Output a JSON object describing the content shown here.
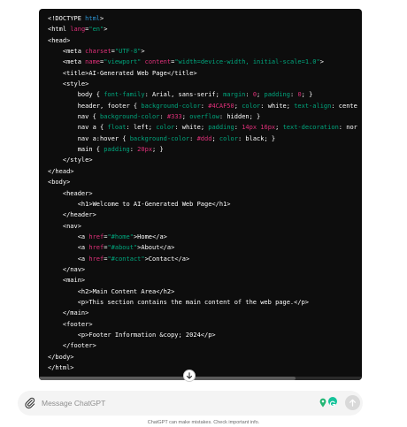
{
  "code_block": {
    "language": "html",
    "colors": {
      "text": "#ffffff",
      "tag": "#2e95d3",
      "attr": "#df3079",
      "string": "#00a67d",
      "css_value": "#df3079",
      "background": "#0d0d0d"
    },
    "lines": [
      [
        {
          "t": "<!DOCTYPE ",
          "c": "text"
        },
        {
          "t": "html",
          "c": "tag"
        },
        {
          "t": ">",
          "c": "text"
        }
      ],
      [
        {
          "t": "<html ",
          "c": "text"
        },
        {
          "t": "lang",
          "c": "attr"
        },
        {
          "t": "=",
          "c": "text"
        },
        {
          "t": "\"en\"",
          "c": "string"
        },
        {
          "t": ">",
          "c": "text"
        }
      ],
      [
        {
          "t": "<head>",
          "c": "text"
        }
      ],
      [
        {
          "t": "    <meta ",
          "c": "text"
        },
        {
          "t": "charset",
          "c": "attr"
        },
        {
          "t": "=",
          "c": "text"
        },
        {
          "t": "\"UTF-8\"",
          "c": "string"
        },
        {
          "t": ">",
          "c": "text"
        }
      ],
      [
        {
          "t": "    <meta ",
          "c": "text"
        },
        {
          "t": "name",
          "c": "attr"
        },
        {
          "t": "=",
          "c": "text"
        },
        {
          "t": "\"viewport\"",
          "c": "string"
        },
        {
          "t": " ",
          "c": "text"
        },
        {
          "t": "content",
          "c": "attr"
        },
        {
          "t": "=",
          "c": "text"
        },
        {
          "t": "\"width=device-width, initial-scale=1.0\"",
          "c": "string"
        },
        {
          "t": ">",
          "c": "text"
        }
      ],
      [
        {
          "t": "    <title>AI-Generated Web Page</title>",
          "c": "text"
        }
      ],
      [
        {
          "t": "    <style>",
          "c": "text"
        }
      ],
      [
        {
          "t": "        body { ",
          "c": "text"
        },
        {
          "t": "font-family",
          "c": "string"
        },
        {
          "t": ": Arial, sans-serif; ",
          "c": "text"
        },
        {
          "t": "margin",
          "c": "string"
        },
        {
          "t": ": ",
          "c": "text"
        },
        {
          "t": "0",
          "c": "css_value"
        },
        {
          "t": "; ",
          "c": "text"
        },
        {
          "t": "padding",
          "c": "string"
        },
        {
          "t": ": ",
          "c": "text"
        },
        {
          "t": "0",
          "c": "css_value"
        },
        {
          "t": "; }",
          "c": "text"
        }
      ],
      [
        {
          "t": "        header, footer { ",
          "c": "text"
        },
        {
          "t": "background-color",
          "c": "string"
        },
        {
          "t": ": ",
          "c": "text"
        },
        {
          "t": "#4CAF50",
          "c": "css_value"
        },
        {
          "t": "; ",
          "c": "text"
        },
        {
          "t": "color",
          "c": "string"
        },
        {
          "t": ": white; ",
          "c": "text"
        },
        {
          "t": "text-align",
          "c": "string"
        },
        {
          "t": ": cente",
          "c": "text"
        }
      ],
      [
        {
          "t": "        nav { ",
          "c": "text"
        },
        {
          "t": "background-color",
          "c": "string"
        },
        {
          "t": ": ",
          "c": "text"
        },
        {
          "t": "#333",
          "c": "css_value"
        },
        {
          "t": "; ",
          "c": "text"
        },
        {
          "t": "overflow",
          "c": "string"
        },
        {
          "t": ": hidden; }",
          "c": "text"
        }
      ],
      [
        {
          "t": "        nav a { ",
          "c": "text"
        },
        {
          "t": "float",
          "c": "string"
        },
        {
          "t": ": left; ",
          "c": "text"
        },
        {
          "t": "color",
          "c": "string"
        },
        {
          "t": ": white; ",
          "c": "text"
        },
        {
          "t": "padding",
          "c": "string"
        },
        {
          "t": ": ",
          "c": "text"
        },
        {
          "t": "14px 16px",
          "c": "css_value"
        },
        {
          "t": "; ",
          "c": "text"
        },
        {
          "t": "text-decoration",
          "c": "string"
        },
        {
          "t": ": nor",
          "c": "text"
        }
      ],
      [
        {
          "t": "        nav a:hover { ",
          "c": "text"
        },
        {
          "t": "background-color",
          "c": "string"
        },
        {
          "t": ": ",
          "c": "text"
        },
        {
          "t": "#ddd",
          "c": "css_value"
        },
        {
          "t": "; ",
          "c": "text"
        },
        {
          "t": "color",
          "c": "string"
        },
        {
          "t": ": black; }",
          "c": "text"
        }
      ],
      [
        {
          "t": "        main { ",
          "c": "text"
        },
        {
          "t": "padding",
          "c": "string"
        },
        {
          "t": ": ",
          "c": "text"
        },
        {
          "t": "20px",
          "c": "css_value"
        },
        {
          "t": "; }",
          "c": "text"
        }
      ],
      [
        {
          "t": "    </style>",
          "c": "text"
        }
      ],
      [
        {
          "t": "</head>",
          "c": "text"
        }
      ],
      [
        {
          "t": "<body>",
          "c": "text"
        }
      ],
      [
        {
          "t": "    <header>",
          "c": "text"
        }
      ],
      [
        {
          "t": "        <h1>Welcome to AI-Generated Web Page</h1>",
          "c": "text"
        }
      ],
      [
        {
          "t": "    </header>",
          "c": "text"
        }
      ],
      [
        {
          "t": "    <nav>",
          "c": "text"
        }
      ],
      [
        {
          "t": "        <a ",
          "c": "text"
        },
        {
          "t": "href",
          "c": "attr"
        },
        {
          "t": "=",
          "c": "text"
        },
        {
          "t": "\"#home\"",
          "c": "string"
        },
        {
          "t": ">Home</a>",
          "c": "text"
        }
      ],
      [
        {
          "t": "        <a ",
          "c": "text"
        },
        {
          "t": "href",
          "c": "attr"
        },
        {
          "t": "=",
          "c": "text"
        },
        {
          "t": "\"#about\"",
          "c": "string"
        },
        {
          "t": ">About</a>",
          "c": "text"
        }
      ],
      [
        {
          "t": "        <a ",
          "c": "text"
        },
        {
          "t": "href",
          "c": "attr"
        },
        {
          "t": "=",
          "c": "text"
        },
        {
          "t": "\"#contact\"",
          "c": "string"
        },
        {
          "t": ">Contact</a>",
          "c": "text"
        }
      ],
      [
        {
          "t": "    </nav>",
          "c": "text"
        }
      ],
      [
        {
          "t": "    <main>",
          "c": "text"
        }
      ],
      [
        {
          "t": "        <h2>Main Content Area</h2>",
          "c": "text"
        }
      ],
      [
        {
          "t": "        <p>This section contains the main content of the web page.</p>",
          "c": "text"
        }
      ],
      [
        {
          "t": "    </main>",
          "c": "text"
        }
      ],
      [
        {
          "t": "    <footer>",
          "c": "text"
        }
      ],
      [
        {
          "t": "        <p>Footer Information &copy; 2024</p>",
          "c": "text"
        }
      ],
      [
        {
          "t": "    </footer>",
          "c": "text"
        }
      ],
      [
        {
          "t": "</body>",
          "c": "text"
        }
      ],
      [
        {
          "t": "</html>",
          "c": "text"
        }
      ]
    ]
  },
  "composer": {
    "placeholder": "Message ChatGPT",
    "attach_icon": "paperclip-icon",
    "send_icon": "arrow-up-icon"
  },
  "scroll_down_icon": "arrow-down-icon",
  "disclaimer": "ChatGPT can make mistakes. Check important info."
}
